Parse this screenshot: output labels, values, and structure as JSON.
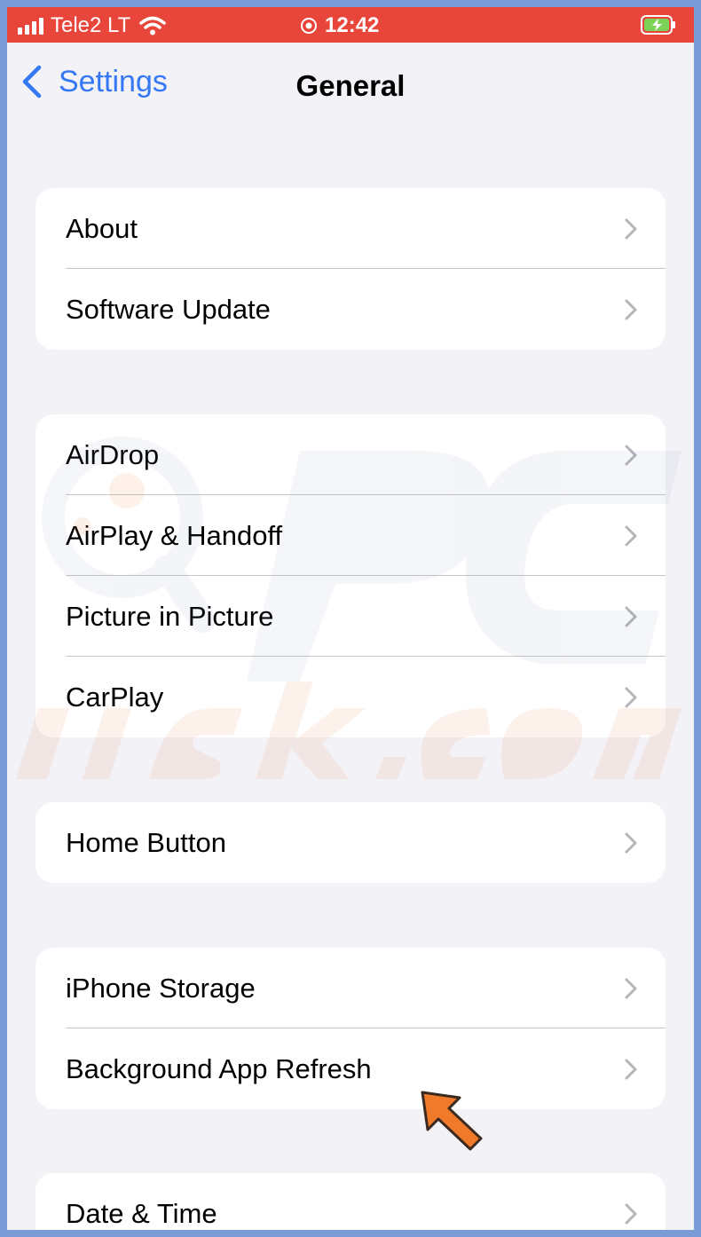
{
  "status_bar": {
    "carrier": "Tele2 LT",
    "time": "12:42",
    "background_color": "#e8463b"
  },
  "nav": {
    "back_label": "Settings",
    "title": "General"
  },
  "groups": [
    {
      "rows": [
        {
          "label": "About"
        },
        {
          "label": "Software Update"
        }
      ]
    },
    {
      "rows": [
        {
          "label": "AirDrop"
        },
        {
          "label": "AirPlay & Handoff"
        },
        {
          "label": "Picture in Picture"
        },
        {
          "label": "CarPlay"
        }
      ]
    },
    {
      "rows": [
        {
          "label": "Home Button"
        }
      ]
    },
    {
      "rows": [
        {
          "label": "iPhone Storage"
        },
        {
          "label": "Background App Refresh"
        }
      ]
    },
    {
      "rows": [
        {
          "label": "Date & Time"
        }
      ]
    }
  ],
  "icons": {
    "back": "chevron-left-icon",
    "row_disclosure": "chevron-right-icon",
    "annotation": "pointer-arrow-icon"
  },
  "accent_color": "#3478f6",
  "annotation_color": "#f07a2a"
}
